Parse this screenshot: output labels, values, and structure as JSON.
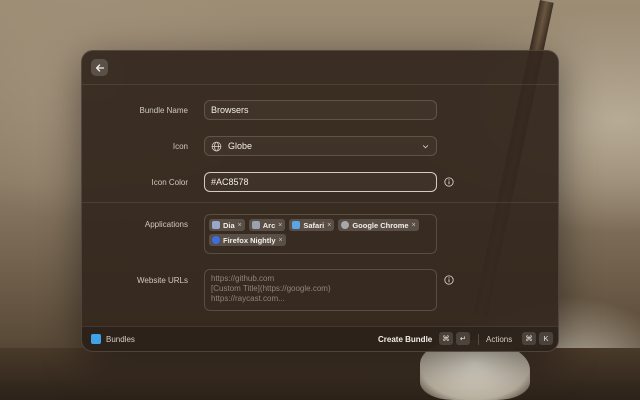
{
  "form": {
    "bundle_name": {
      "label": "Bundle Name",
      "value": "Browsers"
    },
    "icon": {
      "label": "Icon",
      "value": "Globe",
      "icon_name": "globe-icon"
    },
    "icon_color": {
      "label": "Icon Color",
      "value": "#AC8578"
    },
    "applications": {
      "label": "Applications",
      "items": [
        {
          "name": "Dia",
          "color": "#9aa7c9"
        },
        {
          "name": "Arc",
          "color": "#9aa1b0"
        },
        {
          "name": "Safari",
          "color": "#5aa4e8"
        },
        {
          "name": "Google Chrome",
          "color": "#a8a8a8"
        },
        {
          "name": "Firefox Nightly",
          "color": "#3b6ee0"
        }
      ],
      "remove_glyph": "×"
    },
    "website_urls": {
      "label": "Website URLs",
      "placeholder_lines": [
        "https://github.com",
        "[Custom Title](https://google.com)",
        "https://raycast.com..."
      ]
    }
  },
  "footer": {
    "title": "Bundles",
    "primary_action": "Create Bundle",
    "primary_keys": [
      "⌘",
      "↵"
    ],
    "actions_label": "Actions",
    "actions_keys": [
      "⌘",
      "K"
    ]
  },
  "colors": {
    "bundle_icon": "#3fa1e8"
  }
}
